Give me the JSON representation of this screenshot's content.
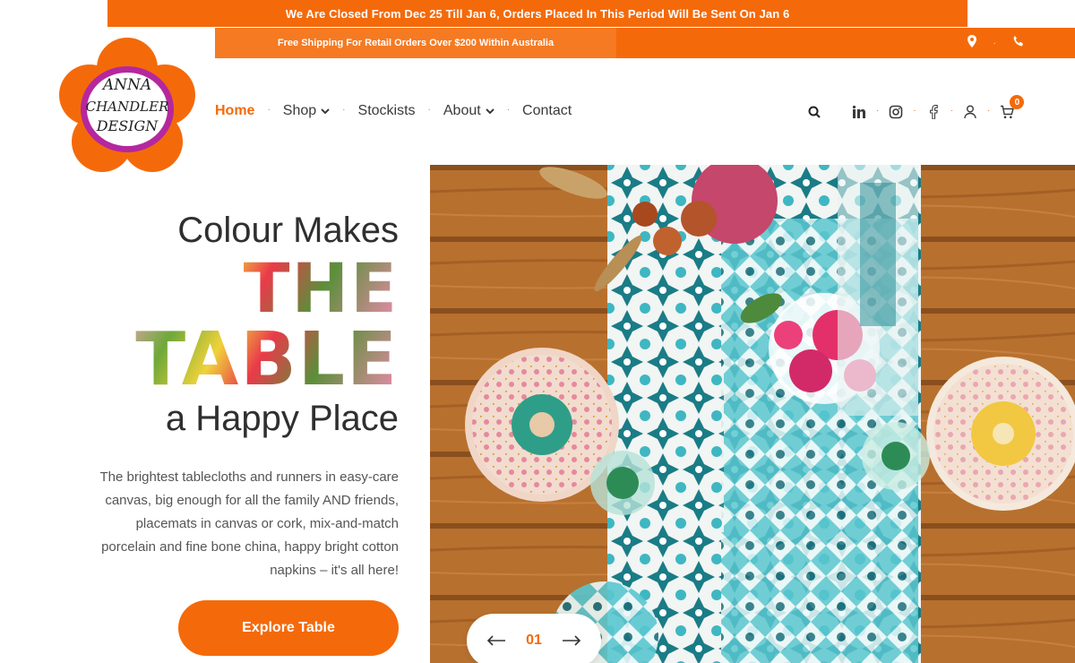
{
  "banner": {
    "closed_notice": "We Are Closed From Dec 25 Till Jan 6, Orders Placed In This Period Will Be Sent On Jan 6"
  },
  "shipping": {
    "text": "Free Shipping For Retail Orders Over $200 Within Australia",
    "icons": [
      "location-pin-icon",
      "phone-icon"
    ]
  },
  "logo": {
    "text_lines": [
      "ANNA",
      "CHANDLER",
      "DESIGN"
    ]
  },
  "nav": {
    "items": [
      {
        "label": "Home",
        "active": true
      },
      {
        "label": "Shop",
        "dropdown": true
      },
      {
        "label": "Stockists"
      },
      {
        "label": "About",
        "dropdown": true
      },
      {
        "label": "Contact"
      }
    ]
  },
  "header_icons": [
    "search-icon",
    "linkedin-icon",
    "instagram-icon",
    "facebook-icon",
    "user-icon",
    "cart-icon"
  ],
  "cart": {
    "count": "0"
  },
  "hero": {
    "line1": "Colour Makes",
    "line2": "THE",
    "line3": "TABLE",
    "line4": "a Happy Place",
    "description": "The brightest tablecloths and runners in easy-care canvas, big enough for all the family AND friends, placemats in canvas or cork, mix-and-match porcelain and fine bone china, happy bright cotton napkins – it's all here!",
    "cta_label": "Explore Table"
  },
  "slider": {
    "current": "01"
  },
  "colors": {
    "brand_orange": "#f46a0a",
    "logo_magenta": "#b5279e",
    "text": "#3a3a3a"
  }
}
